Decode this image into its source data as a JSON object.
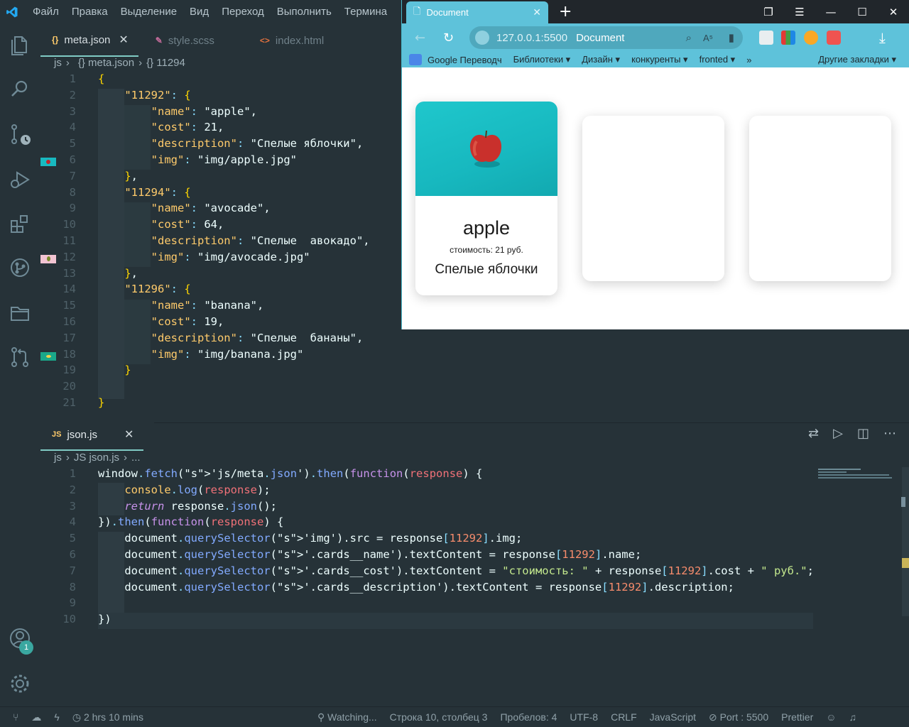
{
  "menu": [
    "Файл",
    "Правка",
    "Выделение",
    "Вид",
    "Переход",
    "Выполнить",
    "Термина"
  ],
  "editor_top": {
    "tabs": [
      {
        "icon": "{}",
        "label": "meta.json",
        "active": true
      },
      {
        "icon": "✎",
        "label": "style.scss",
        "active": false
      },
      {
        "icon": "<>",
        "label": "index.html",
        "active": false
      }
    ],
    "breadcrumb": [
      "js",
      "{} meta.json",
      "{} 11294"
    ]
  },
  "editor_bottom": {
    "tab": {
      "icon": "JS",
      "label": "json.js"
    },
    "breadcrumb": [
      "js",
      "JS json.js",
      "..."
    ]
  },
  "json_lines": [
    "{",
    "    \"11292\": {",
    "        \"name\": \"apple\",",
    "        \"cost\": 21,",
    "        \"description\": \"Спелые яблочки\",",
    "        \"img\": \"img/apple.jpg\"",
    "    },",
    "    \"11294\": {",
    "        \"name\": \"avocade\",",
    "        \"cost\": 64,",
    "        \"description\": \"Спелые  авокадо\",",
    "        \"img\": \"img/avocade.jpg\"",
    "    },",
    "    \"11296\": {",
    "        \"name\": \"banana\",",
    "        \"cost\": 19,",
    "        \"description\": \"Спелые  бананы\",",
    "        \"img\": \"img/banana.jpg\"",
    "    }",
    "",
    "}"
  ],
  "js_lines": [
    "window.fetch('js/meta.json').then(function(response) {",
    "    console.log(response);",
    "    return response.json();",
    "}).then(function(response) {",
    "    document.querySelector('img').src = response[11292].img;",
    "    document.querySelector('.cards__name').textContent = response[11292].name;",
    "    document.querySelector('.cards__cost').textContent = \"стоимость: \" + response[11292].cost + \" руб.\";",
    "    document.querySelector('.cards__description').textContent = response[11292].description;",
    "",
    "})"
  ],
  "activity_badge": "1",
  "status": {
    "time": "2 hrs 10 mins",
    "watching": "Watching...",
    "position": "Строка 10, столбец 3",
    "spaces": "Пробелов: 4",
    "encoding": "UTF-8",
    "eol": "CRLF",
    "language": "JavaScript",
    "port": "Port : 5500",
    "formatter": "Prettier"
  },
  "browser": {
    "tab_title": "Document",
    "url": "127.0.0.1:5500",
    "page_title": "Document",
    "bookmarks": [
      "Google Переводч",
      "Библиотеки ▾",
      "Дизайн ▾",
      "конкуренты ▾",
      "fronted ▾"
    ],
    "bookmarks_more": "»",
    "other_bookmarks": "Другие закладки ▾",
    "card": {
      "name": "apple",
      "cost": "стоимость: 21 руб.",
      "description": "Спелые яблочки"
    }
  },
  "colors": {
    "editor_bg": "#263238",
    "browser_accent": "#5ec2da",
    "card_image_bg": "#1fc7cc"
  }
}
